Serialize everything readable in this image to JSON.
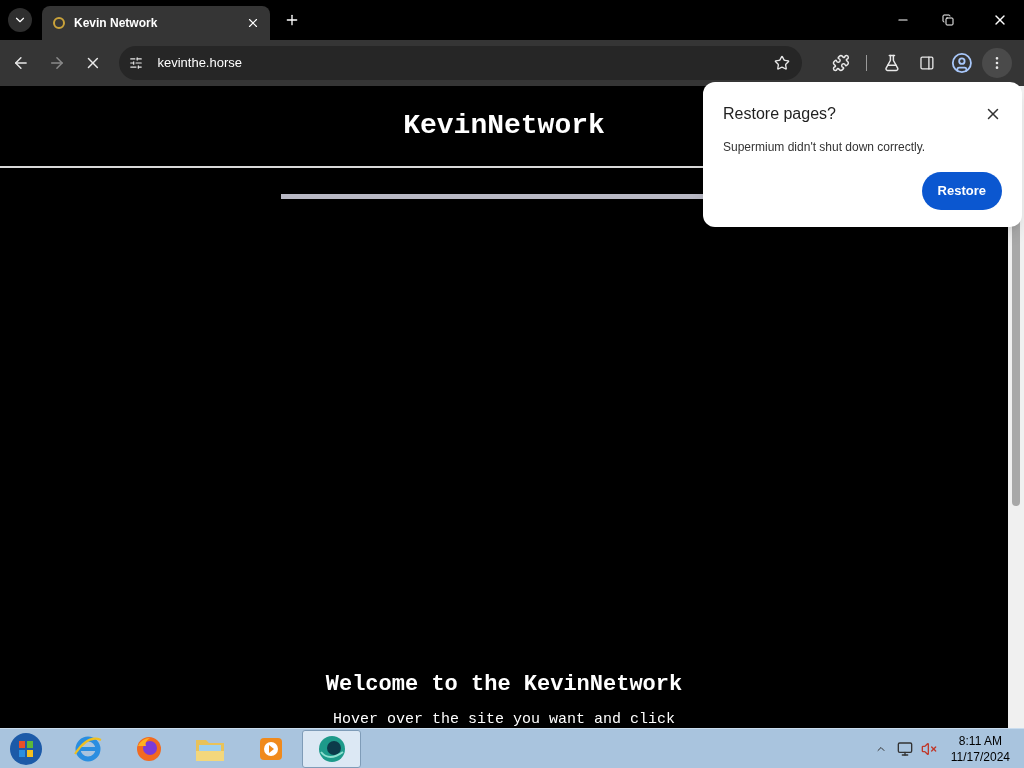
{
  "browser": {
    "tabs": [
      {
        "title": "Kevin Network",
        "selected": true
      }
    ],
    "loading": true,
    "address": "kevinthe.horse"
  },
  "page": {
    "heading": "KevinNetwork",
    "welcome": "Welcome to the KevinNetwork",
    "instruction": "Hover over the site you want and click"
  },
  "dialog": {
    "title": "Restore pages?",
    "message": "Supermium didn't shut down correctly.",
    "button": "Restore"
  },
  "taskbar": {
    "apps": [
      {
        "kind": "ie",
        "selected": false
      },
      {
        "kind": "firefox",
        "selected": false
      },
      {
        "kind": "explorer",
        "selected": false
      },
      {
        "kind": "media",
        "selected": false
      },
      {
        "kind": "browser",
        "selected": true
      }
    ],
    "time": "8:11 AM",
    "date": "11/17/2024"
  }
}
